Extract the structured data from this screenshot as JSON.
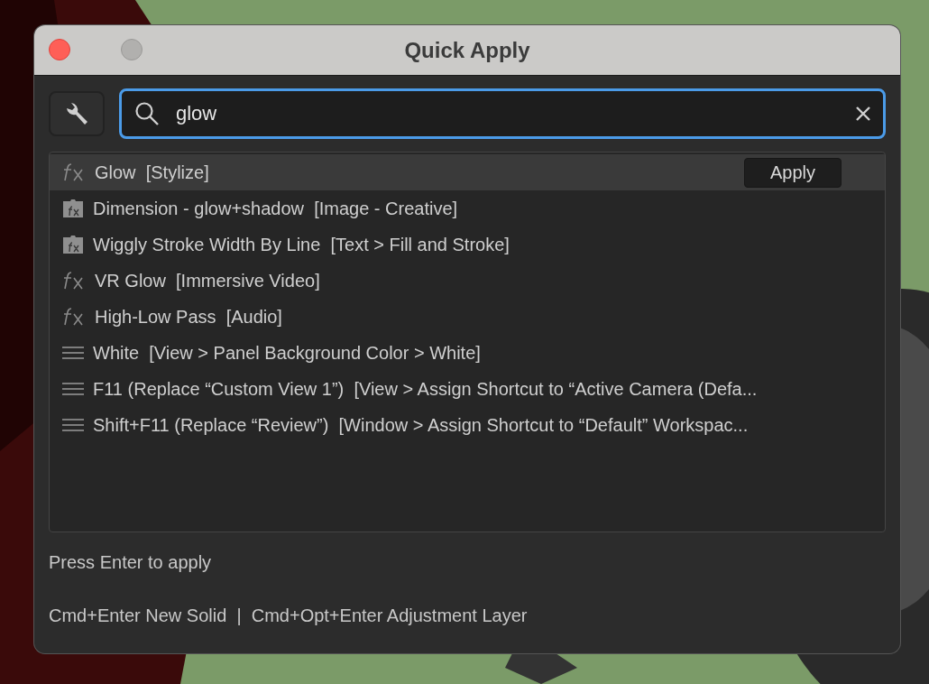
{
  "window": {
    "title": "Quick Apply"
  },
  "search": {
    "value": "glow"
  },
  "results": [
    {
      "kind": "fx",
      "name": "Glow",
      "category": "[Stylize]",
      "selected": true,
      "action": "Apply"
    },
    {
      "kind": "preset",
      "name": "Dimension - glow+shadow",
      "category": "[Image - Creative]",
      "selected": false
    },
    {
      "kind": "preset",
      "name": "Wiggly Stroke Width By Line",
      "category": "[Text > Fill and Stroke]",
      "selected": false
    },
    {
      "kind": "fx",
      "name": "VR Glow",
      "category": "[Immersive Video]",
      "selected": false
    },
    {
      "kind": "fx",
      "name": "High-Low Pass",
      "category": "[Audio]",
      "selected": false
    },
    {
      "kind": "menu",
      "name": "White",
      "category": "[View > Panel Background Color > White]",
      "selected": false
    },
    {
      "kind": "menu",
      "name": "F11 (Replace “Custom View 1”)",
      "category": "[View > Assign Shortcut to “Active Camera (Defa...",
      "selected": false
    },
    {
      "kind": "menu",
      "name": "Shift+F11 (Replace “Review”)",
      "category": "[Window > Assign Shortcut to “Default” Workspac...",
      "selected": false
    }
  ],
  "hint": "Press Enter to apply",
  "shortcuts": "Cmd+Enter New Solid  |  Cmd+Opt+Enter Adjustment Layer"
}
